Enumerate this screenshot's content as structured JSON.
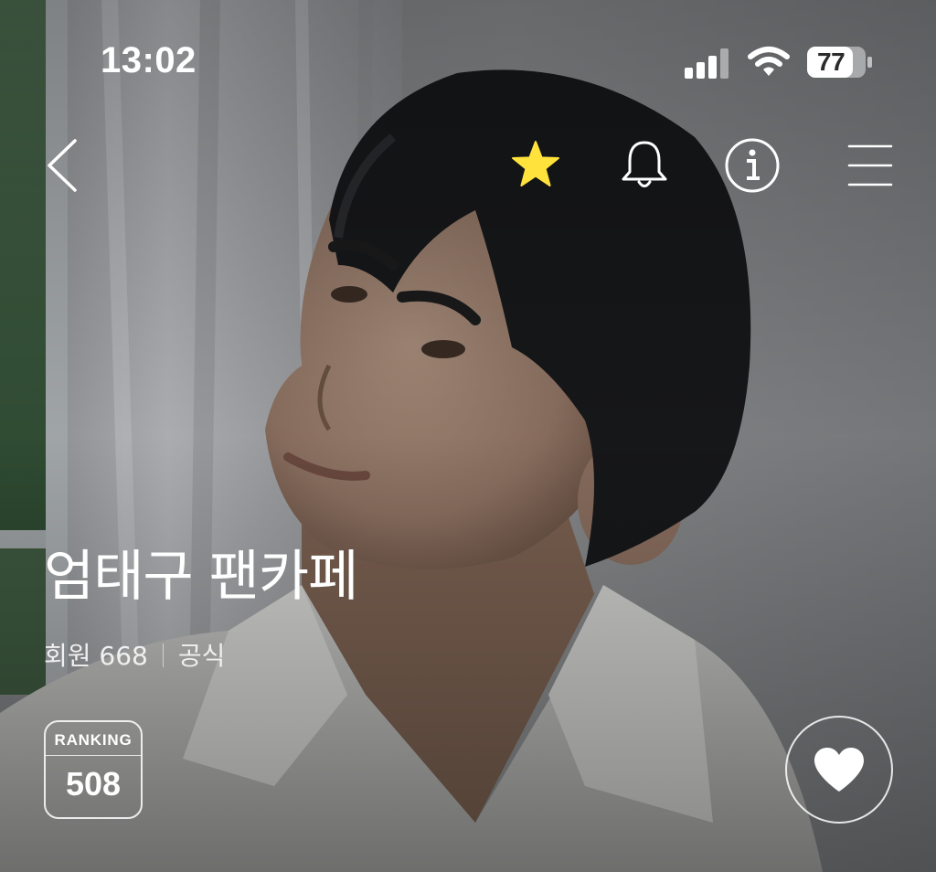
{
  "status_bar": {
    "time": "13:02",
    "battery": "77",
    "icons": [
      "cellular-signal-icon",
      "wifi-icon",
      "battery-icon"
    ]
  },
  "nav": {
    "icons": [
      "back-arrow-icon",
      "star-icon",
      "bell-icon",
      "info-icon",
      "menu-icon"
    ],
    "star_color": "#FFE23B"
  },
  "cafe": {
    "title": "엄태구 팬카페",
    "members_label": "회원 668",
    "official_label": "공식"
  },
  "ranking": {
    "label": "RANKING",
    "value": "508"
  },
  "like": {
    "icon": "heart-icon"
  }
}
